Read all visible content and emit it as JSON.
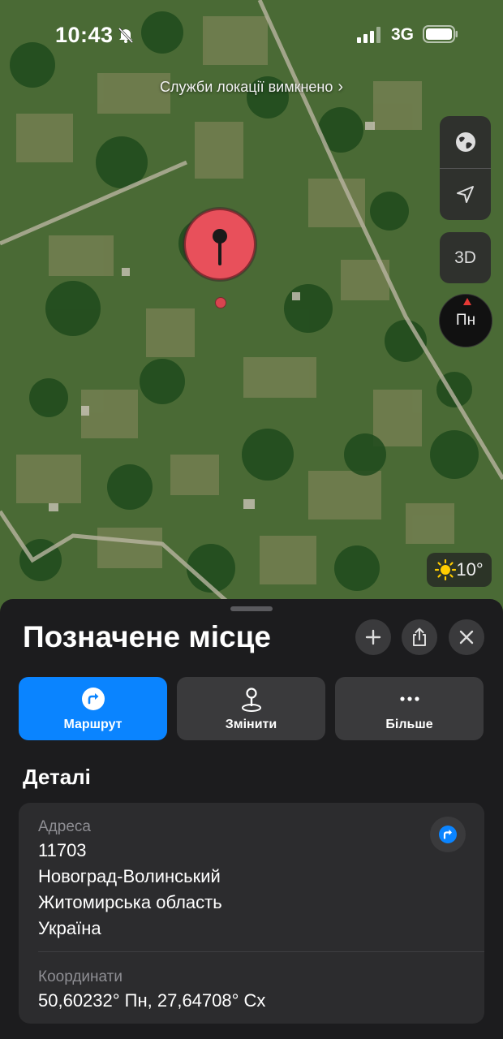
{
  "status_bar": {
    "time": "10:43",
    "network": "3G"
  },
  "map": {
    "location_banner": "Служби локації вимкнено",
    "controls": {
      "globe_icon": "globe-icon",
      "locate_icon": "location-arrow-icon",
      "view_3d_label": "3D"
    },
    "compass_label": "Пн",
    "weather": {
      "icon": "sun-icon",
      "temperature": "10°"
    },
    "pin_icon": "map-pin-icon"
  },
  "sheet": {
    "title": "Позначене місце",
    "header_buttons": [
      "plus-icon",
      "share-icon",
      "close-icon"
    ],
    "actions": [
      {
        "label": "Маршрут",
        "icon": "directions-icon"
      },
      {
        "label": "Змінити",
        "icon": "pin-edit-icon"
      },
      {
        "label": "Більше",
        "icon": "ellipsis-icon"
      }
    ],
    "details_heading": "Деталі",
    "address": {
      "caption": "Адреса",
      "lines": [
        "11703",
        "Новоград-Волинський",
        "Житомирська область",
        "Україна"
      ]
    },
    "coordinates": {
      "caption": "Координати",
      "value": "50,60232° Пн, 27,64708° Сх"
    }
  },
  "colors": {
    "accent": "#0a84ff",
    "pin": "#e8505b",
    "sheet_bg": "#1c1c1e",
    "card_bg": "#2c2c2e"
  }
}
